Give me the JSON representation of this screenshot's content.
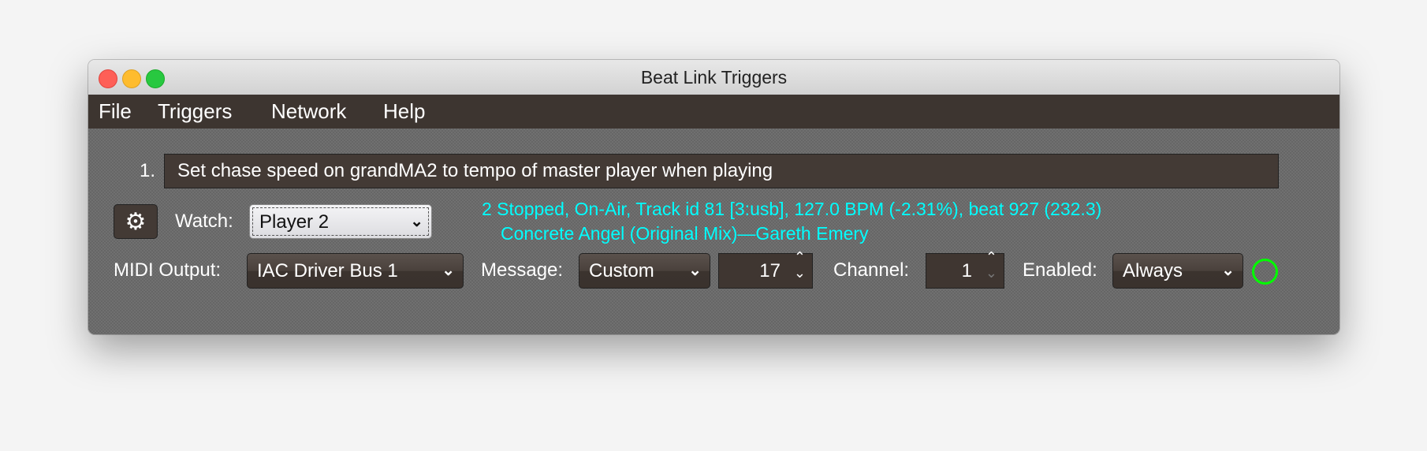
{
  "window": {
    "title": "Beat Link Triggers"
  },
  "menu": [
    "File",
    "Triggers",
    "Network",
    "Help"
  ],
  "trigger": {
    "index": "1.",
    "comment": "Set chase speed on grandMA2 to tempo of master player when playing",
    "watch_label": "Watch:",
    "watch_value": "Player 2",
    "status_line1": "2 Stopped, On-Air, Track id 81 [3:usb], 127.0 BPM (-2.31%), beat 927 (232.3)",
    "status_line2": "Concrete Angel (Original Mix)—Gareth Emery",
    "midi_output_label": "MIDI Output:",
    "midi_output_value": "IAC Driver Bus 1",
    "message_label": "Message:",
    "message_value": "Custom",
    "note_value": "17",
    "channel_label": "Channel:",
    "channel_value": "1",
    "enabled_label": "Enabled:",
    "enabled_value": "Always"
  },
  "colors": {
    "status": "#00ffff",
    "indicator": "#00ff00",
    "menubar": "#3d3530"
  }
}
